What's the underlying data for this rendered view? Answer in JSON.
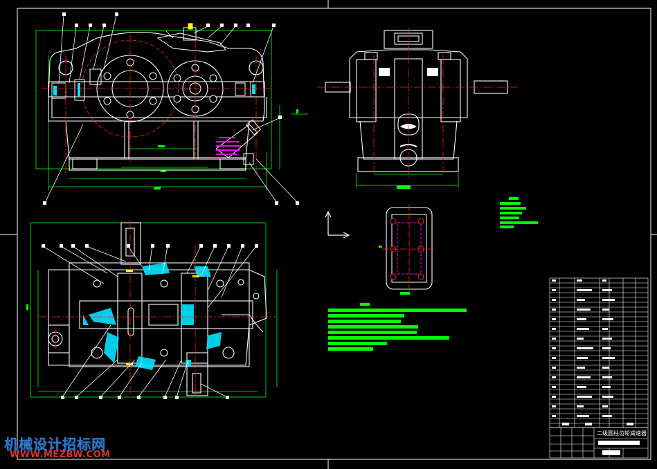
{
  "drawing": {
    "title": "二级圆柱齿轮减速器",
    "watermark_cn": "机械设计招标网",
    "watermark_url": "WWW.MEZBW.COM"
  },
  "colors": {
    "background": "#000000",
    "outline": "#ffffff",
    "centerline": "#ff2020",
    "dimension": "#00ff00",
    "hatch": "#00e5ff",
    "magenta": "#ff00ff",
    "yellow": "#ffff00",
    "watermark_blue": "#2f79c8",
    "watermark_red": "#d8342c"
  },
  "views": [
    "front-view",
    "side-view",
    "top-section-view",
    "bearing-cover-view",
    "technical-notes",
    "parts-list",
    "title-block"
  ]
}
